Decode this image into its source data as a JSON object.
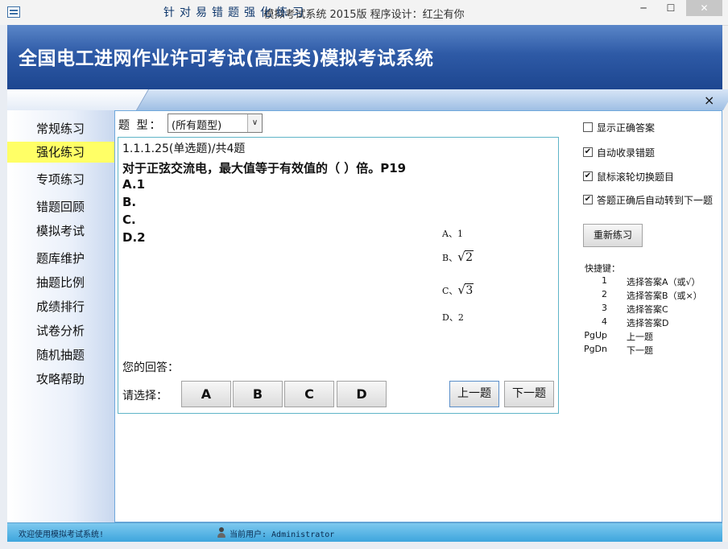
{
  "window": {
    "title": "模拟考试系统 2015版   程序设计：红尘有你",
    "minimize": "─",
    "maximize": "☐",
    "close": "✕"
  },
  "header": {
    "title": "全国电工进网作业许可考试(高压类)模拟考试系统"
  },
  "subheader": {
    "title": "针对易错题强化练习",
    "close": "×"
  },
  "sidebar": {
    "items": [
      {
        "label": "常规练习",
        "active": false
      },
      {
        "label": "强化练习",
        "active": true
      },
      {
        "label": "专项练习",
        "active": false
      },
      {
        "label": "错题回顾",
        "active": false
      },
      {
        "label": "模拟考试",
        "active": false
      },
      {
        "label": "题库维护",
        "active": false
      },
      {
        "label": "抽题比例",
        "active": false
      },
      {
        "label": "成绩排行",
        "active": false
      },
      {
        "label": "试卷分析",
        "active": false
      },
      {
        "label": "随机抽题",
        "active": false
      },
      {
        "label": "攻略帮助",
        "active": false
      }
    ]
  },
  "filter": {
    "label": "题  型：",
    "selected": "(所有题型)",
    "arrow": "∨"
  },
  "question": {
    "number": "1.1.1.25(单选题)/共4题",
    "text": "对于正弦交流电，最大值等于有效值的（   ）倍。P19",
    "options": [
      "A.1",
      "B.",
      "C.",
      "D.2"
    ],
    "image_options": {
      "a": "A、1",
      "b_prefix": "B、",
      "b_radicand": "2",
      "c_prefix": "C、",
      "c_radicand": "3",
      "d": "D、2"
    }
  },
  "answer": {
    "label": "您的回答：",
    "choose_label": "请选择：",
    "buttons": [
      "A",
      "B",
      "C",
      "D"
    ],
    "prev": "上一题",
    "next": "下一题"
  },
  "settings": {
    "checkboxes": [
      {
        "label": "显示正确答案",
        "checked": false
      },
      {
        "label": "自动收录错题",
        "checked": true
      },
      {
        "label": "鼠标滚轮切换题目",
        "checked": true
      },
      {
        "label": "答题正确后自动转到下一题",
        "checked": true
      }
    ],
    "check_mark": "✔",
    "retry": "重新练习"
  },
  "shortcuts": {
    "title": "快捷键：",
    "items": [
      {
        "key": "1",
        "desc": "选择答案A（或√）"
      },
      {
        "key": "2",
        "desc": "选择答案B（或×）"
      },
      {
        "key": "3",
        "desc": "选择答案C"
      },
      {
        "key": "4",
        "desc": "选择答案D"
      },
      {
        "key": "PgUp",
        "desc": "上一题"
      },
      {
        "key": "PgDn",
        "desc": "下一题"
      }
    ]
  },
  "status": {
    "welcome": "欢迎使用模拟考试系统!",
    "user": "当前用户: Administrator"
  },
  "colors": {
    "header": "#2e5aa6",
    "active_item": "#ffff66",
    "panel_border": "#6fa8dc",
    "statusbar": "#3aa4dc"
  }
}
